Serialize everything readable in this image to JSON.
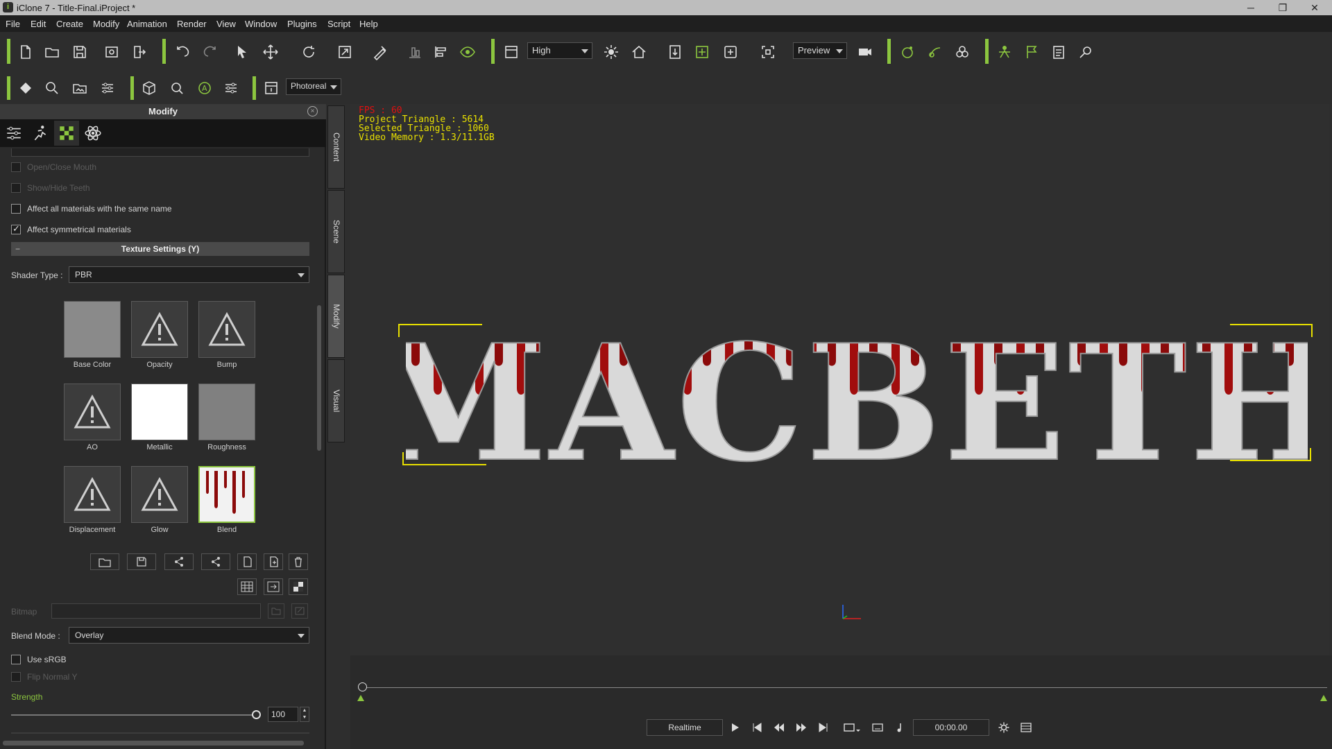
{
  "app": {
    "title": "iClone 7 - Title-Final.iProject *",
    "icon": "iclone-app-icon"
  },
  "window_controls": {
    "minimize": "─",
    "restore": "❐",
    "close": "✕"
  },
  "menu": [
    "File",
    "Edit",
    "Create",
    "Modify",
    "Animation",
    "Render",
    "View",
    "Window",
    "Plugins",
    "Script",
    "Help"
  ],
  "toolbar": {
    "quality_value": "High",
    "preview_value": "Preview",
    "render_mode_value": "Photoreal",
    "accent_color": "#8cc63f"
  },
  "panel": {
    "title": "Modify",
    "close_symbol": "×",
    "options": {
      "open_close_mouth": "Open/Close Mouth",
      "show_hide_teeth": "Show/Hide Teeth",
      "affect_same_name": "Affect all materials with the same name",
      "affect_symmetrical": "Affect symmetrical materials",
      "affect_symmetrical_checked": true,
      "affect_same_name_checked": false
    },
    "texture_section": {
      "title": "Texture Settings  (Y)",
      "collapse_symbol": "−"
    },
    "shader": {
      "label": "Shader Type :",
      "value": "PBR"
    },
    "channels": [
      "Base Color",
      "Opacity",
      "Bump",
      "AO",
      "Metallic",
      "Roughness",
      "Displacement",
      "Glow",
      "Blend"
    ],
    "bitmap_label": "Bitmap",
    "blend_mode": {
      "label": "Blend Mode :",
      "value": "Overlay"
    },
    "use_srgb": "Use sRGB",
    "use_srgb_checked": false,
    "flip_normal_y": "Flip Normal Y",
    "strength": {
      "label": "Strength",
      "value": "100",
      "level_percent": 100
    }
  },
  "side_tabs": [
    "Content",
    "Scene",
    "Modify",
    "Visual"
  ],
  "viewport": {
    "fps": "FPS : 60",
    "project_triangle": "Project Triangle : 5614",
    "selected_triangle": "Selected Triangle : 1060",
    "video_memory": "Video Memory : 1.3/11.1GB",
    "scene_text": "MACBETH"
  },
  "playback": {
    "mode": "Realtime",
    "time": "00:00.00"
  }
}
